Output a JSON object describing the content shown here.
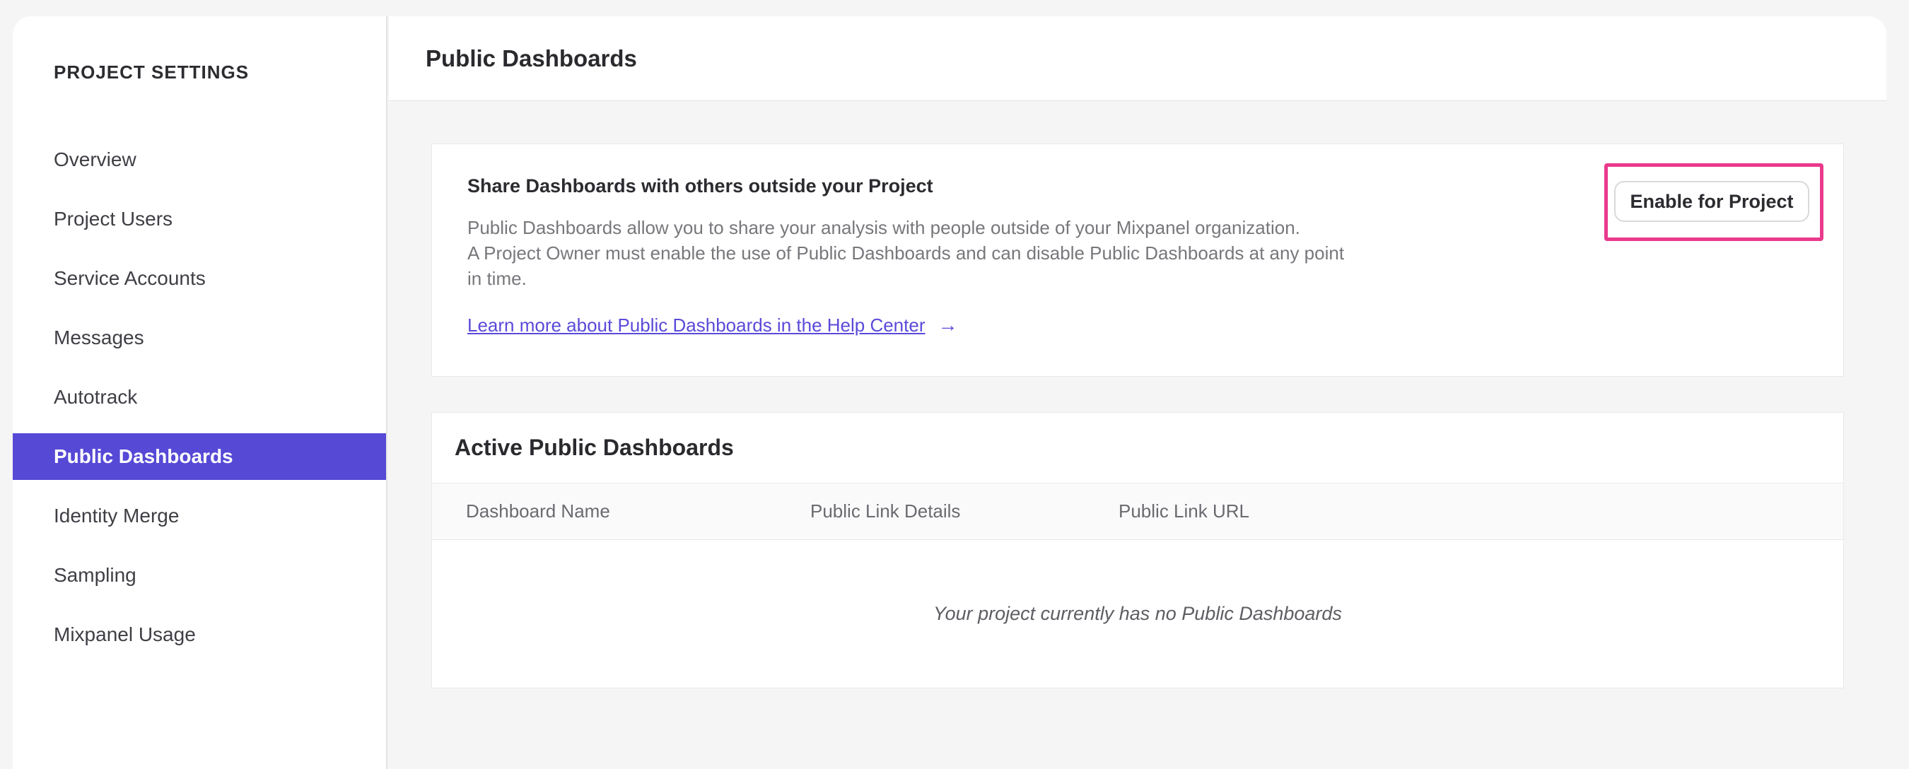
{
  "colors": {
    "accent_purple": "#5649d6",
    "accent_pink": "#e93a8c",
    "accent_link": "#5a4ad9"
  },
  "sidebar": {
    "title": "PROJECT SETTINGS",
    "items": [
      {
        "label": "Overview",
        "selected": false
      },
      {
        "label": "Project Users",
        "selected": false
      },
      {
        "label": "Service Accounts",
        "selected": false
      },
      {
        "label": "Messages",
        "selected": false
      },
      {
        "label": "Autotrack",
        "selected": false
      },
      {
        "label": "Public Dashboards",
        "selected": true
      },
      {
        "label": "Identity Merge",
        "selected": false
      },
      {
        "label": "Sampling",
        "selected": false
      },
      {
        "label": "Mixpanel Usage",
        "selected": false
      }
    ]
  },
  "header": {
    "title": "Public Dashboards"
  },
  "share_card": {
    "heading": "Share Dashboards with others outside your Project",
    "body": "Public Dashboards allow you to share your analysis with people outside of your Mixpanel organization.\nA Project Owner must enable the use of Public Dashboards and can disable Public Dashboards at any point\nin time.",
    "link_label": "Learn more about Public Dashboards in the Help Center",
    "link_arrow": "→",
    "button_label": "Enable for Project"
  },
  "active_card": {
    "title": "Active Public Dashboards",
    "columns": [
      "Dashboard Name",
      "Public Link Details",
      "Public Link URL"
    ],
    "empty_message": "Your project currently has no Public Dashboards"
  }
}
